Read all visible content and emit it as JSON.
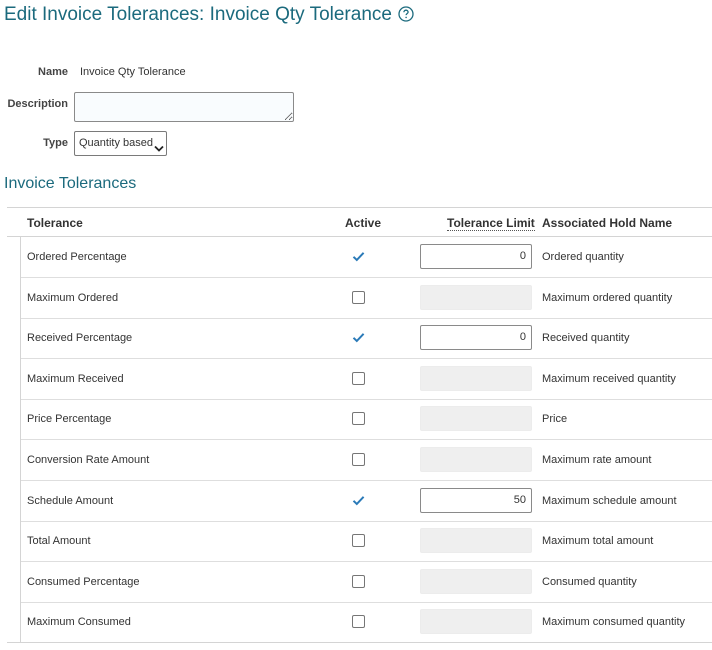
{
  "page": {
    "title": "Edit Invoice Tolerances: Invoice Qty Tolerance"
  },
  "form": {
    "name_label": "Name",
    "name_value": "Invoice Qty Tolerance",
    "description_label": "Description",
    "description_value": "",
    "type_label": "Type",
    "type_value": "Quantity based"
  },
  "section": {
    "title": "Invoice Tolerances"
  },
  "table": {
    "headers": {
      "tolerance": "Tolerance",
      "active": "Active",
      "limit": "Tolerance Limit",
      "hold": "Associated Hold Name"
    },
    "rows": [
      {
        "tolerance": "Ordered Percentage",
        "active": true,
        "limit": "0",
        "hold": "Ordered quantity"
      },
      {
        "tolerance": "Maximum Ordered",
        "active": false,
        "limit": "",
        "hold": "Maximum ordered quantity"
      },
      {
        "tolerance": "Received Percentage",
        "active": true,
        "limit": "0",
        "hold": "Received quantity"
      },
      {
        "tolerance": "Maximum Received",
        "active": false,
        "limit": "",
        "hold": "Maximum received quantity"
      },
      {
        "tolerance": "Price Percentage",
        "active": false,
        "limit": "",
        "hold": "Price"
      },
      {
        "tolerance": "Conversion Rate Amount",
        "active": false,
        "limit": "",
        "hold": "Maximum rate amount"
      },
      {
        "tolerance": "Schedule Amount",
        "active": true,
        "limit": "50",
        "hold": "Maximum schedule amount"
      },
      {
        "tolerance": "Total Amount",
        "active": false,
        "limit": "",
        "hold": "Maximum total amount"
      },
      {
        "tolerance": "Consumed Percentage",
        "active": false,
        "limit": "",
        "hold": "Consumed quantity"
      },
      {
        "tolerance": "Maximum Consumed",
        "active": false,
        "limit": "",
        "hold": "Maximum consumed quantity"
      }
    ]
  },
  "icons": {
    "help": "help-circle-icon",
    "checkmark": "checkmark-icon",
    "dropdown": "chevron-down-icon"
  },
  "colors": {
    "title": "#1b6a7d",
    "check": "#2a7ab8",
    "disabled_field": "#efefef"
  }
}
